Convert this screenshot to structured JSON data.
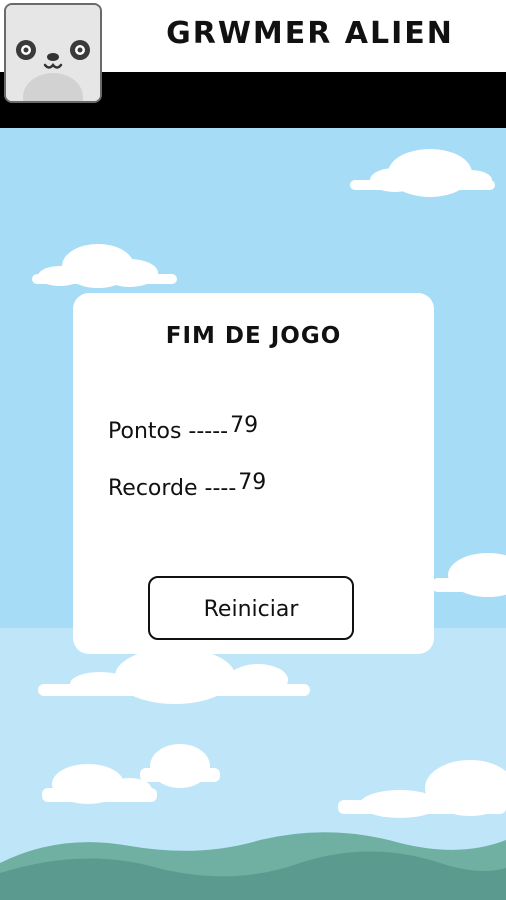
{
  "header": {
    "app_title": "GRWMER ALIEN",
    "icon": "panda-face-icon"
  },
  "game_over": {
    "title": "FIM DE JOGO",
    "score_label": "Pontos -----",
    "score_value": "79",
    "record_label": "Recorde ----",
    "record_value": "79",
    "restart_label": "Reiniciar"
  },
  "colors": {
    "sky": "#a6dcf5",
    "hills_dark": "#5b9a8f",
    "hills_light": "#6fb0a3",
    "cloud": "#ffffff",
    "header_bar": "#000000"
  }
}
